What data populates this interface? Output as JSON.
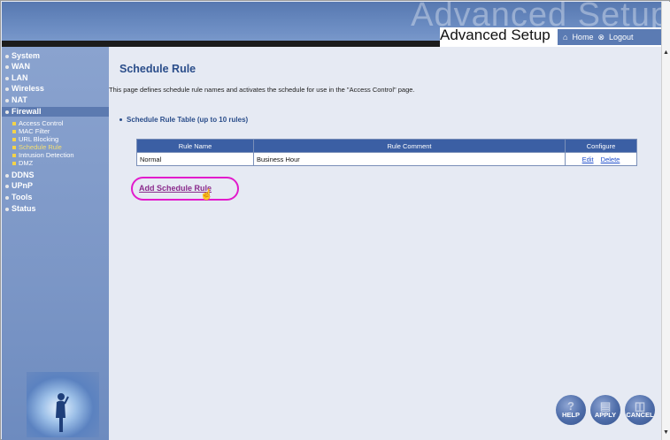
{
  "header": {
    "bg_text": "Advanced Setup",
    "title": "Advanced Setup",
    "home_label": "Home",
    "logout_label": "Logout"
  },
  "sidebar": {
    "items": [
      {
        "label": "System"
      },
      {
        "label": "WAN"
      },
      {
        "label": "LAN"
      },
      {
        "label": "Wireless"
      },
      {
        "label": "NAT"
      },
      {
        "label": "Firewall"
      },
      {
        "label": "DDNS"
      },
      {
        "label": "UPnP"
      },
      {
        "label": "Tools"
      },
      {
        "label": "Status"
      }
    ],
    "firewall_sub": [
      {
        "label": "Access Control"
      },
      {
        "label": "MAC Filter"
      },
      {
        "label": "URL Blocking"
      },
      {
        "label": "Schedule Rule"
      },
      {
        "label": "Intrusion Detection"
      },
      {
        "label": "DMZ"
      }
    ]
  },
  "main": {
    "title": "Schedule Rule",
    "description": "This page defines schedule rule names and activates the schedule for use in the \"Access Control\" page.",
    "table_heading": "Schedule Rule Table (up to 10 rules)",
    "table": {
      "headers": [
        "Rule Name",
        "Rule Comment",
        "Configure"
      ],
      "rows": [
        {
          "name": "Normal",
          "comment": "Business Hour",
          "edit": "Edit",
          "delete": "Delete"
        }
      ]
    },
    "add_rule_label": "Add Schedule Rule"
  },
  "buttons": {
    "help": "HELP",
    "apply": "APPLY",
    "cancel": "CANCEL"
  },
  "colors": {
    "header_blue": "#5b7bb3",
    "title_blue": "#2a4d8a",
    "highlight_magenta": "#e21bcc"
  }
}
